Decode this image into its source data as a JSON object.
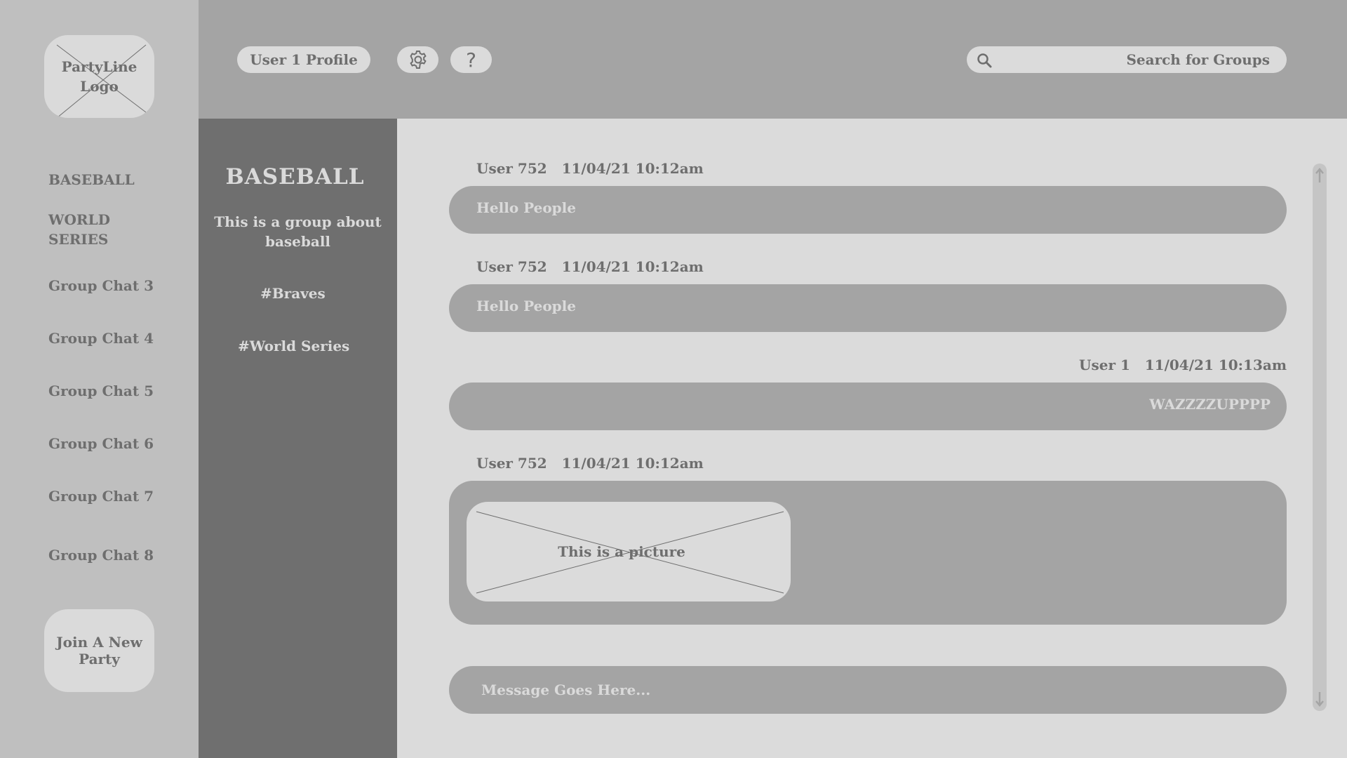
{
  "sidebar": {
    "logo_text": "PartyLine Logo",
    "items": [
      {
        "label": "BASEBALL"
      },
      {
        "label": "WORLD SERIES"
      },
      {
        "label": "Group Chat 3"
      },
      {
        "label": "Group Chat 4"
      },
      {
        "label": "Group Chat 5"
      },
      {
        "label": "Group Chat 6"
      },
      {
        "label": "Group Chat 7"
      },
      {
        "label": "Group Chat 8"
      }
    ],
    "join_label": "Join A New Party"
  },
  "header": {
    "profile_label": "User 1 Profile",
    "settings_icon": "gear-icon",
    "help_label": "?",
    "search_placeholder": "Search for Groups",
    "search_icon": "search-icon"
  },
  "group": {
    "title": "BASEBALL",
    "description": "This is a group about baseball",
    "tags": [
      "#Braves",
      "#World Series"
    ]
  },
  "messages": [
    {
      "user": "User 752",
      "timestamp": "11/04/21 10:12am",
      "text": "Hello People",
      "align": "left"
    },
    {
      "user": "User 752",
      "timestamp": "11/04/21 10:12am",
      "text": "Hello People",
      "align": "left"
    },
    {
      "user": "User 1",
      "timestamp": "11/04/21 10:13am",
      "text": "WAZZZZUPPPP",
      "align": "right"
    },
    {
      "user": "User 752",
      "timestamp": "11/04/21 10:12am",
      "picture_label": "This is a picture",
      "align": "left"
    }
  ],
  "composer": {
    "placeholder": "Message Goes Here..."
  },
  "colors": {
    "sidebar_bg": "#bfbfbf",
    "topbar_bg": "#a4a4a4",
    "group_panel_bg": "#6f6f6f",
    "chat_bg": "#dbdbdb",
    "bubble_bg": "#a4a4a4",
    "text_dark": "#6e6e6e",
    "text_light": "#dadada"
  }
}
